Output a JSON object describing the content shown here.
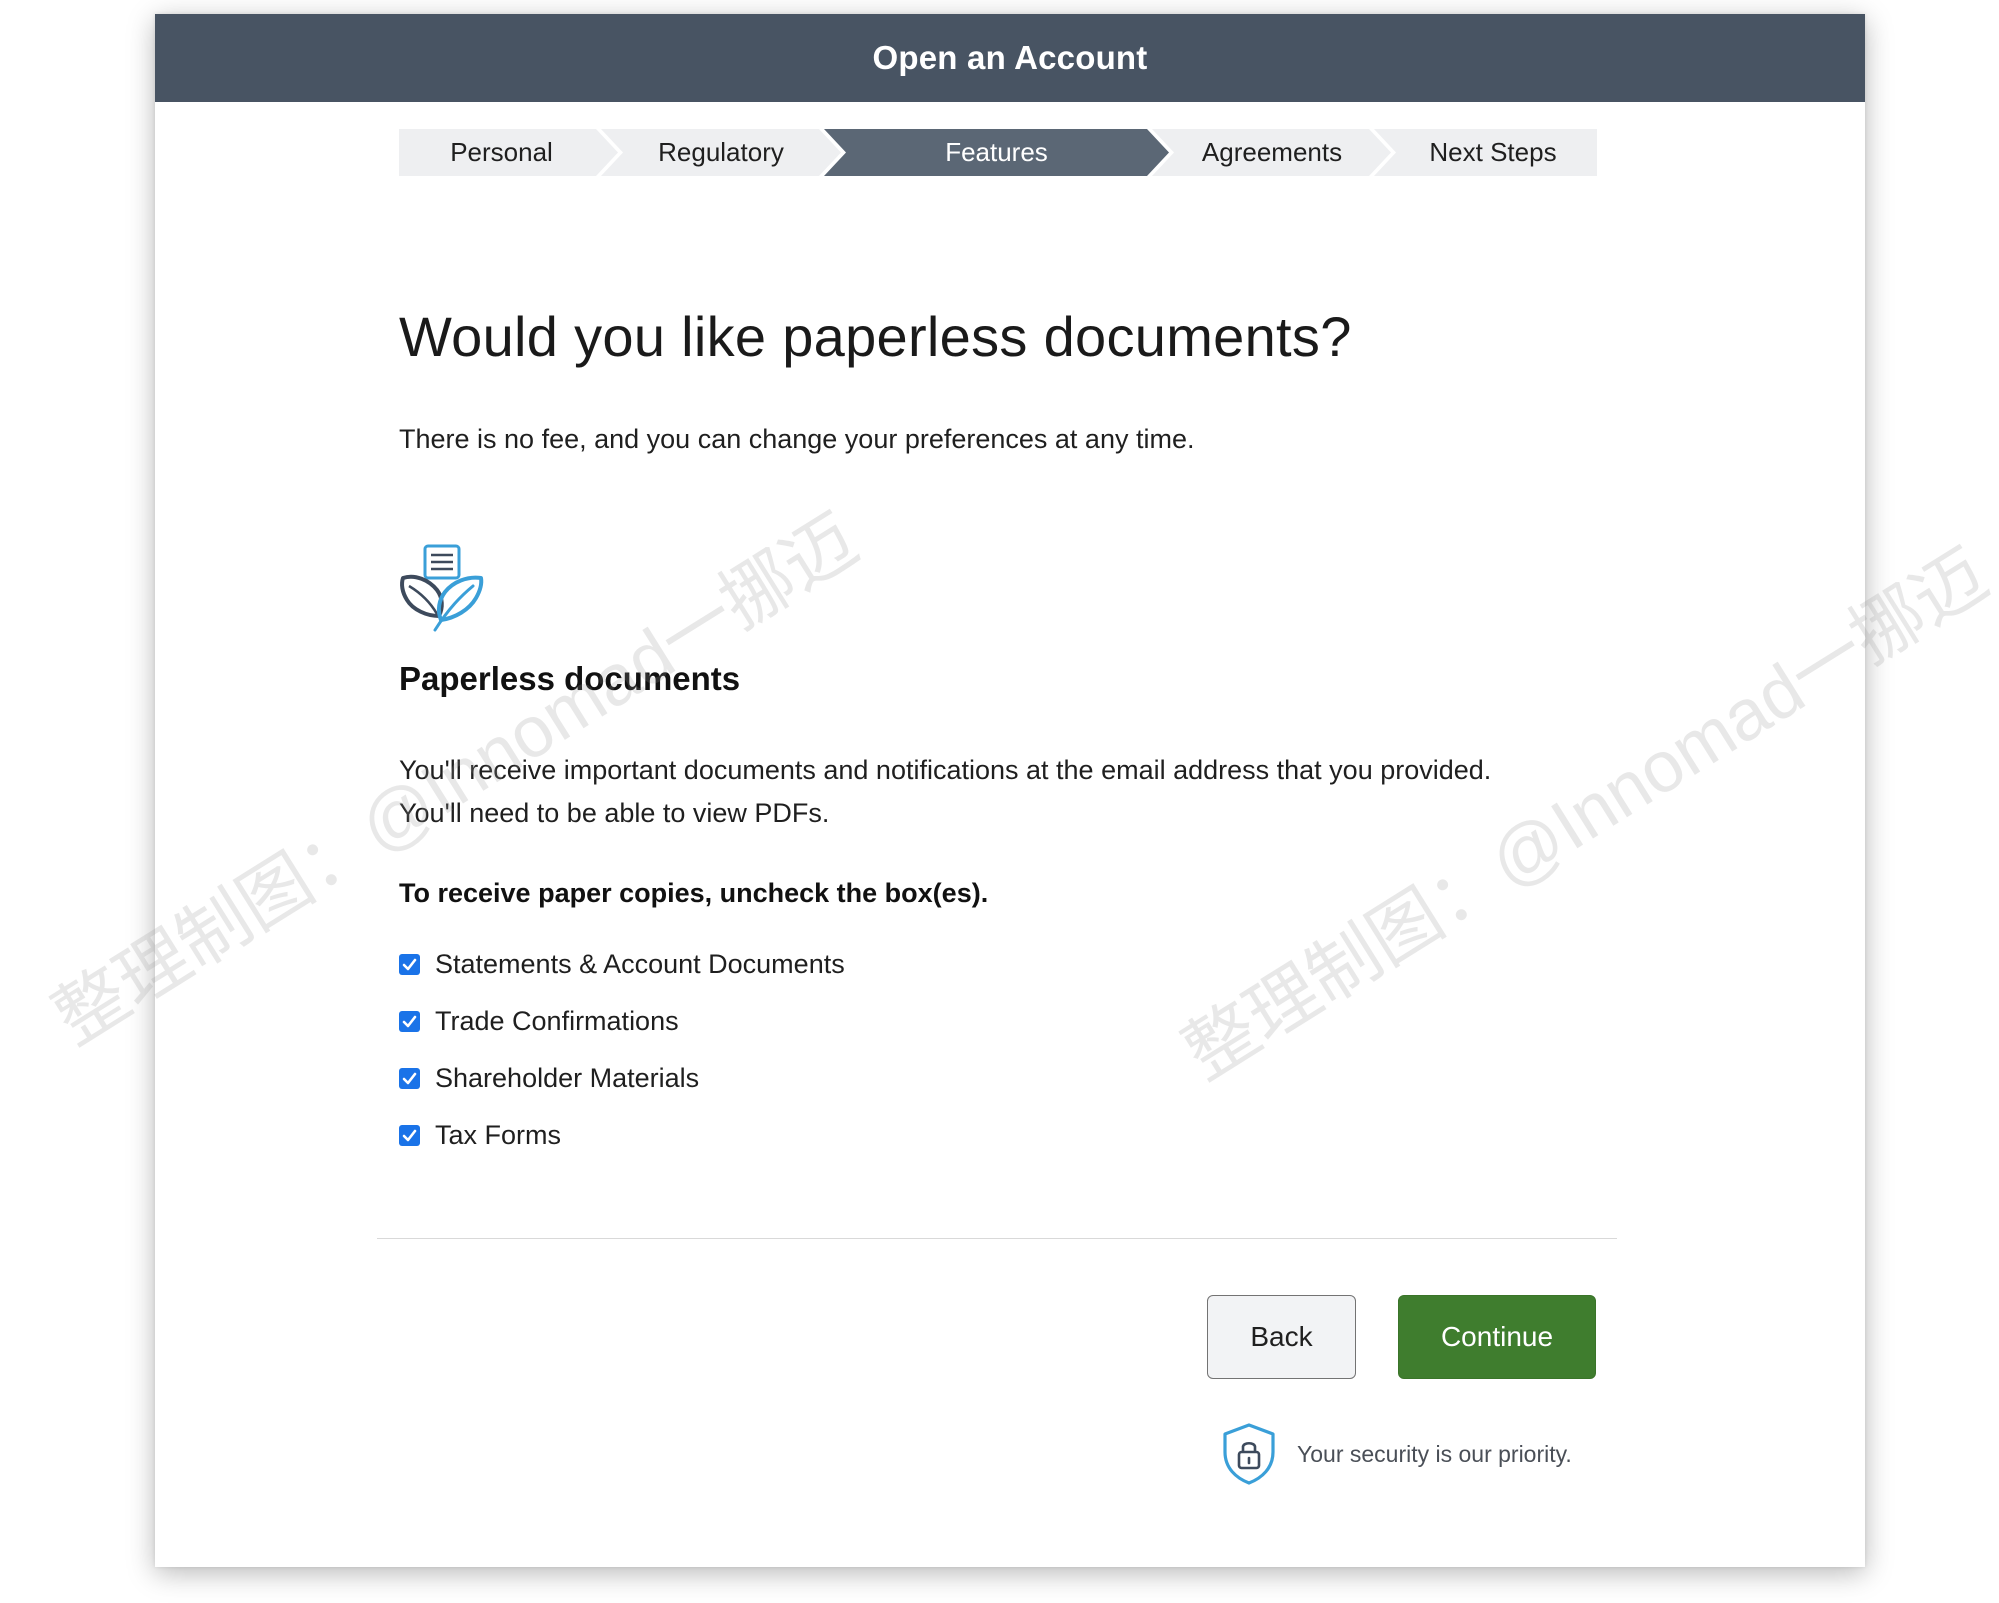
{
  "window": {
    "title": "Open an Account"
  },
  "stepper": {
    "steps": [
      {
        "label": "Personal",
        "state": "complete"
      },
      {
        "label": "Regulatory",
        "state": "complete"
      },
      {
        "label": "Features",
        "state": "active"
      },
      {
        "label": "Agreements",
        "state": "upcoming"
      },
      {
        "label": "Next Steps",
        "state": "upcoming"
      }
    ]
  },
  "main": {
    "heading": "Would you like paperless documents?",
    "subtext": "There is no fee, and you can change your preferences at any time.",
    "feature": {
      "icon": "paperless-leaf-document-icon",
      "title": "Paperless documents",
      "description_line1": "You'll receive important documents and notifications at the email address that you provided.",
      "description_line2": "You'll need to be able to view PDFs."
    },
    "instruction": "To receive paper copies, uncheck the box(es).",
    "options": [
      {
        "label": "Statements & Account Documents",
        "checked": true
      },
      {
        "label": "Trade Confirmations",
        "checked": true
      },
      {
        "label": "Shareholder Materials",
        "checked": true
      },
      {
        "label": "Tax Forms",
        "checked": true
      }
    ]
  },
  "actions": {
    "back_label": "Back",
    "continue_label": "Continue"
  },
  "security": {
    "icon": "shield-lock-icon",
    "text": "Your security is our priority."
  },
  "watermark": {
    "text": "整理制图：@Innomad一挪迈"
  },
  "colors": {
    "header_bg": "#485463",
    "active_step_bg": "#5b6775",
    "inactive_step_bg": "#eeeff1",
    "checkbox": "#1a73e8",
    "continue_button": "#3f7d2e",
    "icon_blue": "#3a9fd8",
    "icon_dark": "#3d4a5c"
  }
}
